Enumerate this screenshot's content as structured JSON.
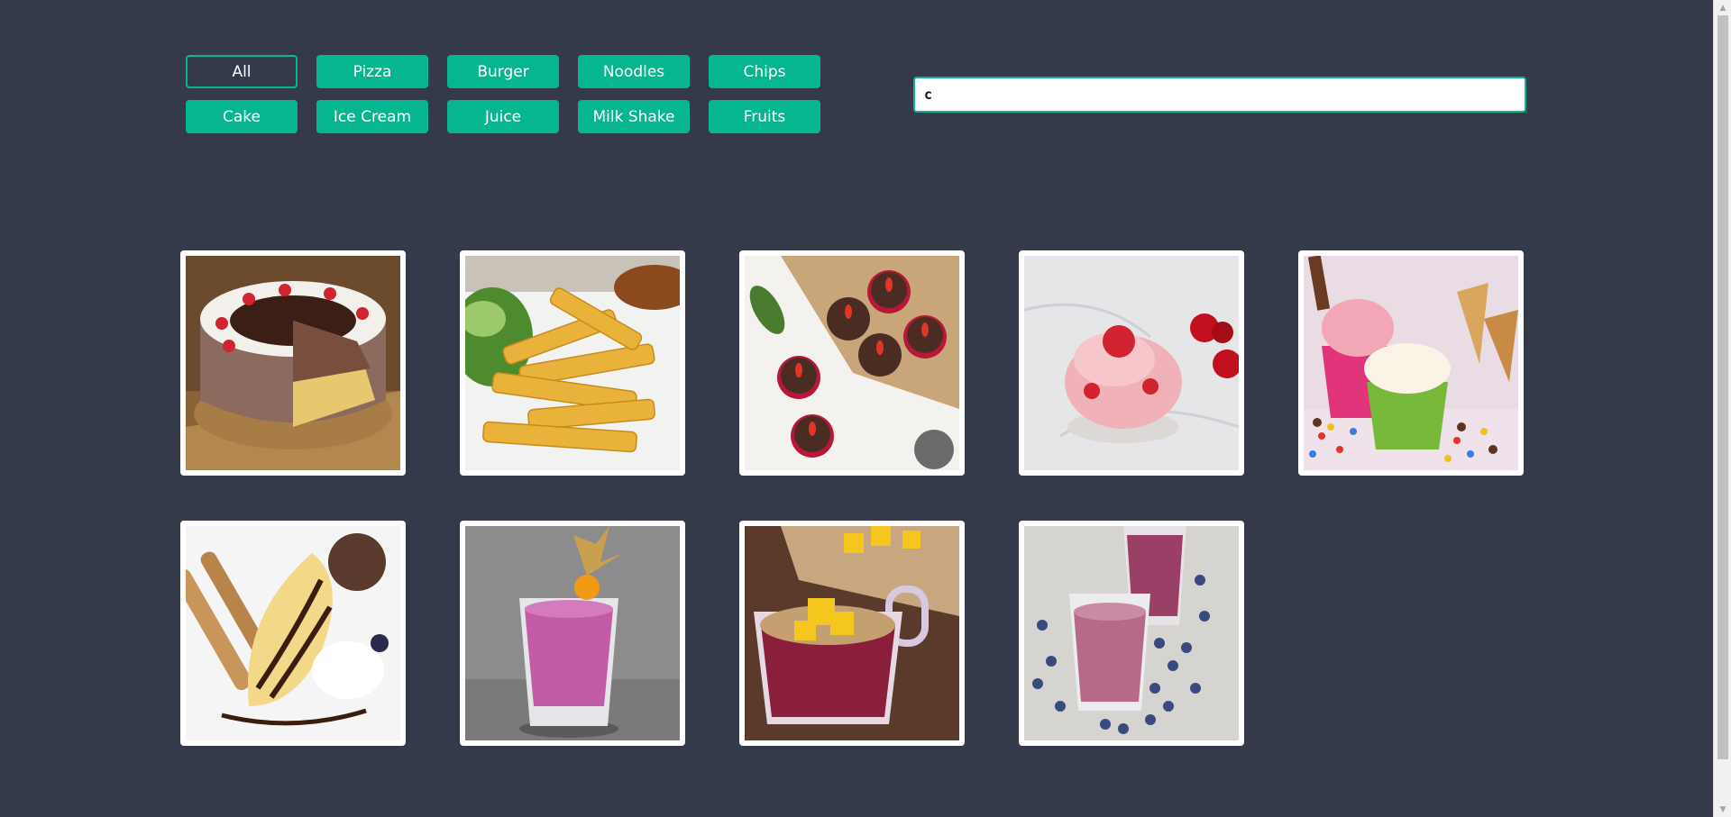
{
  "filters": [
    {
      "label": "All",
      "active": true
    },
    {
      "label": "Pizza"
    },
    {
      "label": "Burger"
    },
    {
      "label": "Noodles"
    },
    {
      "label": "Chips"
    },
    {
      "label": "Cake"
    },
    {
      "label": "Ice Cream"
    },
    {
      "label": "Juice"
    },
    {
      "label": "Milk Shake"
    },
    {
      "label": "Fruits"
    }
  ],
  "search": {
    "value": "c",
    "placeholder": ""
  },
  "gallery": {
    "items": [
      {
        "icon": "chocolate-cake-image"
      },
      {
        "icon": "french-fries-image"
      },
      {
        "icon": "chocolate-truffles-image"
      },
      {
        "icon": "strawberry-dessert-image"
      },
      {
        "icon": "ice-cream-cups-image"
      },
      {
        "icon": "banana-split-image"
      },
      {
        "icon": "berry-smoothie-image"
      },
      {
        "icon": "fruit-bowl-drink-image"
      },
      {
        "icon": "blueberry-juice-image"
      }
    ]
  },
  "colors": {
    "background": "#343a4a",
    "accent": "#06b690",
    "card": "#ffffff"
  }
}
